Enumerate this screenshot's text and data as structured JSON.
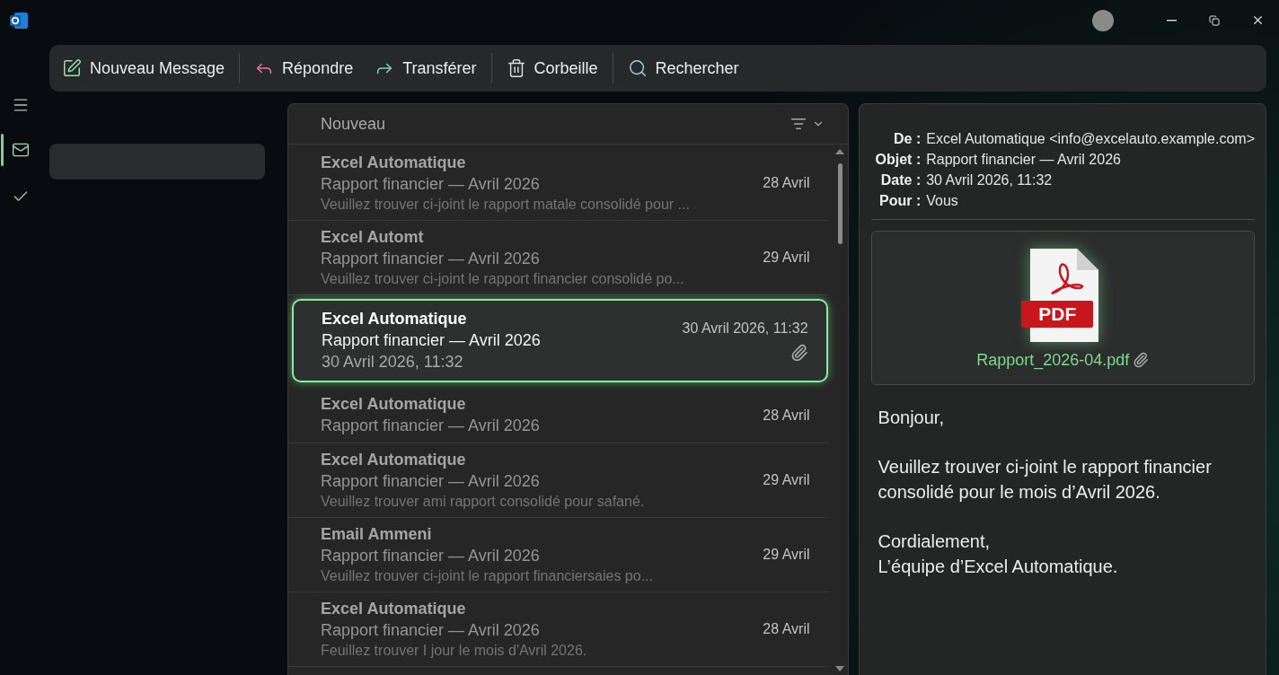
{
  "rail": {
    "items": [
      {
        "kind": "mail",
        "selected": true
      },
      {
        "kind": "tasks",
        "selected": false
      }
    ]
  },
  "toolbar": {
    "buttons": [
      {
        "kind": "new",
        "label": "Nouveau Message"
      },
      {
        "kind": "reply",
        "label": "Répondre"
      },
      {
        "kind": "forward",
        "label": "Transférer"
      },
      {
        "kind": "delete",
        "label": "Corbeille"
      },
      {
        "kind": "search",
        "label": "Rechercher"
      }
    ]
  },
  "message_list": {
    "header": "Nouveau",
    "messages": [
      {
        "sender": "Excel Automatique",
        "subject": "Rapport financier — Avril 2026",
        "preview": "Veuillez trouver ci-joint le rapport matale consolidé pour ...",
        "date": "28 Avril",
        "selected": false,
        "blurred": true,
        "has_attachment": false
      },
      {
        "sender": "Excel Automt",
        "subject": "Rapport financier — Avril 2026",
        "preview": "Veuillez trouver ci-joint le rapport financier consolidé po...",
        "date": "29 Avril",
        "selected": false,
        "blurred": true,
        "has_attachment": false
      },
      {
        "sender": "Excel Automatique",
        "subject": "Rapport financier — Avril 2026",
        "preview": "30 Avril 2026, 11:32",
        "date": "30 Avril 2026, 11:32",
        "selected": true,
        "blurred": false,
        "has_attachment": true
      },
      {
        "sender": "Excel Automatique",
        "subject": "Rapport financier — Avril 2026",
        "date": "28 Avril",
        "selected": false,
        "blurred": true,
        "has_attachment": false
      },
      {
        "sender": "Excel Automatique",
        "subject": "Rapport financier — Avril 2026",
        "preview": "Veuillez trouver ami rapport consolidé pour safané.",
        "date": "29 Avril",
        "selected": false,
        "blurred": true,
        "has_attachment": false
      },
      {
        "sender": "Email Ammeni",
        "subject": "Rapport financier — Avril 2026",
        "preview": "Veuillez trouver ci-joint le rapport financiersaies po...",
        "date": "29 Avril",
        "selected": false,
        "blurred": true,
        "has_attachment": false
      },
      {
        "sender": "Excel Automatique",
        "subject": "Rapport financier — Avril 2026",
        "preview": "Feuillez trouver I jour le mois d'Avril 2026.",
        "date": "28 Avril",
        "selected": false,
        "blurred": true,
        "has_attachment": false
      }
    ]
  },
  "reading_pane": {
    "headers": [
      {
        "label": "De :",
        "value": "Excel Automatique <info@excelauto.example.com>"
      },
      {
        "label": "Objet :",
        "value": "Rapport financier — Avril 2026"
      },
      {
        "label": "Date :",
        "value": "30 Avril 2026, 11:32"
      },
      {
        "label": "Pour :",
        "value": "Vous"
      }
    ],
    "attachment": {
      "badge": "PDF",
      "name": "Rapport_2026-04.pdf"
    },
    "body": [
      [
        "Bonjour,"
      ],
      [
        "Veuillez trouver ci-joint le rapport financier",
        "consolidé pour le mois d’Avril 2026."
      ],
      [
        "Cordialement,",
        "L’équipe d’Excel Automatique."
      ]
    ]
  }
}
